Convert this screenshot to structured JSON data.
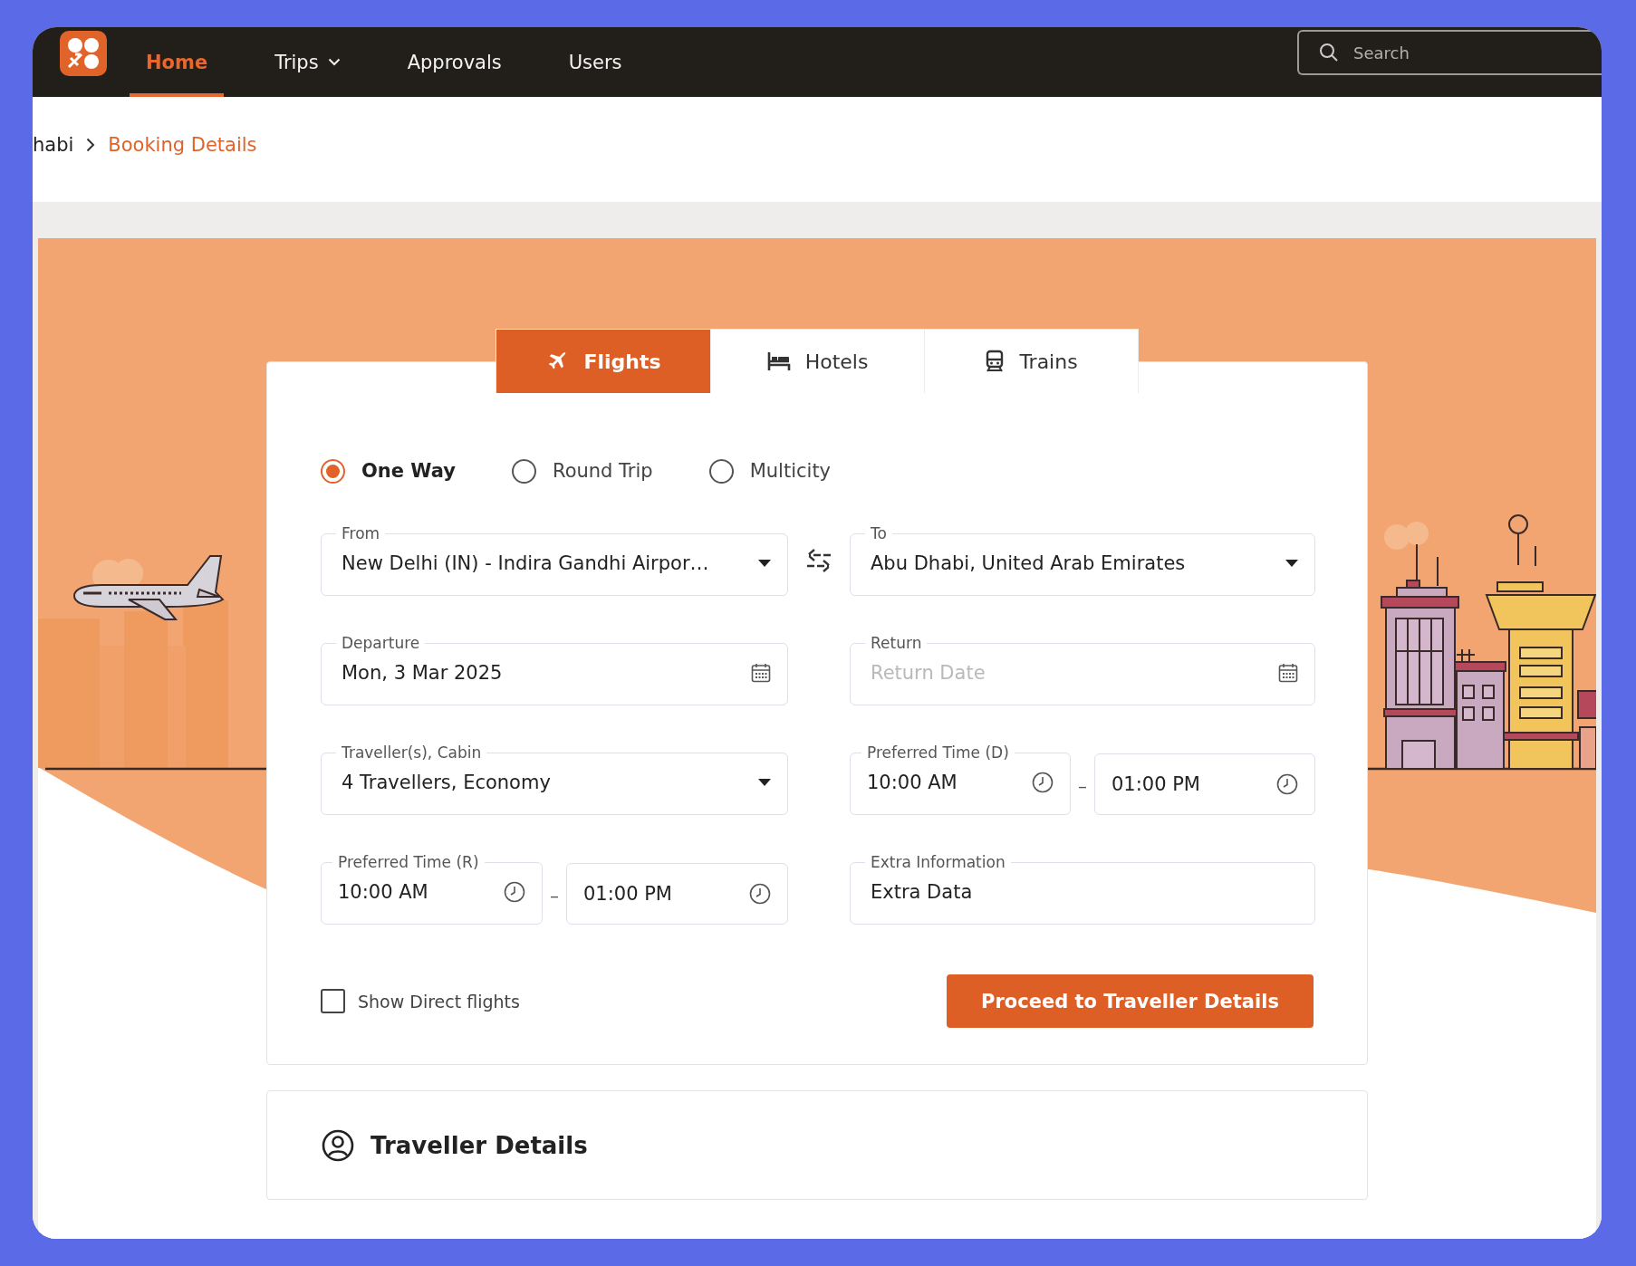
{
  "nav": {
    "items": [
      {
        "label": "Home",
        "selected": true,
        "dropdown": false
      },
      {
        "label": "Trips",
        "selected": false,
        "dropdown": true
      },
      {
        "label": "Approvals",
        "selected": false,
        "dropdown": false
      },
      {
        "label": "Users",
        "selected": false,
        "dropdown": false
      }
    ],
    "search": {
      "placeholder": "Search"
    }
  },
  "breadcrumb": [
    {
      "label": "habi",
      "current": false
    },
    {
      "label": "Booking Details",
      "current": true
    }
  ],
  "tabs": [
    {
      "label": "Flights",
      "kind": "flight",
      "selected": true
    },
    {
      "label": "Hotels",
      "kind": "hotel",
      "selected": false
    },
    {
      "label": "Trains",
      "kind": "train",
      "selected": false
    }
  ],
  "trip_types": [
    {
      "label": "One Way",
      "selected": true
    },
    {
      "label": "Round Trip",
      "selected": false
    },
    {
      "label": "Multicity",
      "selected": false
    }
  ],
  "rows": [
    {
      "swap": true,
      "fields": [
        {
          "kind": "select",
          "label": "From",
          "value": "New Delhi (IN) - Indira Gandhi Airpor…"
        },
        {
          "kind": "select",
          "label": "To",
          "value": "Abu Dhabi, United Arab Emirates"
        }
      ]
    },
    {
      "fields": [
        {
          "kind": "date",
          "label": "Departure",
          "value": "Mon, 3 Mar 2025"
        },
        {
          "kind": "date",
          "label": "Return",
          "placeholder": "Return Date"
        }
      ]
    },
    {
      "fields": [
        {
          "kind": "select",
          "label": "Traveller(s), Cabin",
          "value": "4 Travellers, Economy"
        },
        {
          "kind": "time_range",
          "label": "Preferred Time (D)",
          "start": "10:00 AM",
          "separator": "–",
          "end": "01:00 PM"
        }
      ]
    },
    {
      "fields": [
        {
          "kind": "time_range",
          "label": "Preferred Time (R)",
          "start": "10:00 AM",
          "separator": "–",
          "end": "01:00 PM"
        },
        {
          "kind": "text",
          "label": "Extra Information",
          "value": "Extra Data"
        }
      ]
    }
  ],
  "direct_flights": {
    "label": "Show Direct flights",
    "checked": false
  },
  "submit": {
    "label": "Proceed to Traveller Details"
  },
  "traveller_details": {
    "title": "Traveller Details"
  }
}
